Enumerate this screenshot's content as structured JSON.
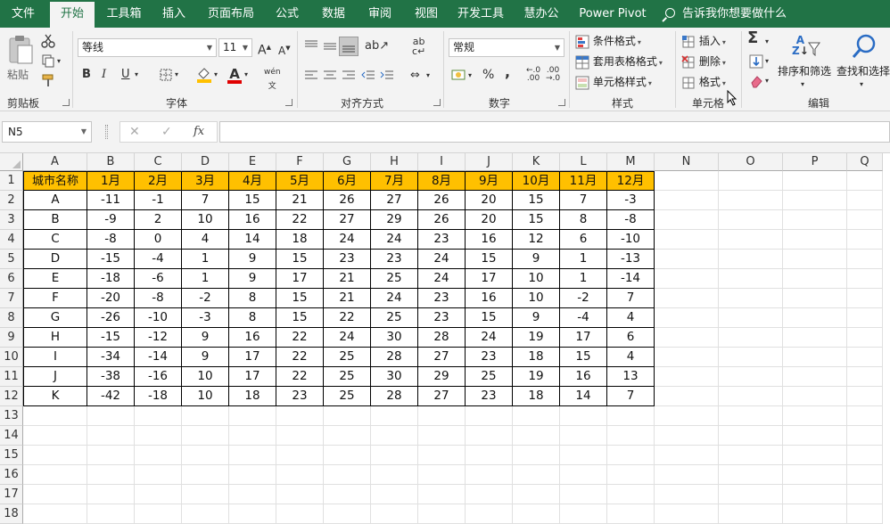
{
  "menu": {
    "tabs": [
      "文件",
      "开始",
      "工具箱",
      "插入",
      "页面布局",
      "公式",
      "数据",
      "审阅",
      "视图",
      "开发工具",
      "慧办公",
      "Power Pivot"
    ],
    "active": "开始",
    "tell_me": "告诉我你想要做什么"
  },
  "ribbon": {
    "clipboard": {
      "paste": "粘贴",
      "label": "剪贴板"
    },
    "font": {
      "name": "等线",
      "size": "11",
      "bold": "B",
      "italic": "I",
      "underline": "U",
      "label": "字体",
      "grow": "A",
      "shrink": "A",
      "phonetic": "wén"
    },
    "alignment": {
      "label": "对齐方式"
    },
    "number": {
      "format": "常规",
      "label": "数字",
      "percent": "%",
      "comma": ","
    },
    "styles": {
      "conditional": "条件格式",
      "table": "套用表格格式",
      "cell": "单元格样式",
      "label": "样式"
    },
    "cells": {
      "insert": "插入",
      "delete": "删除",
      "format": "格式",
      "label": "单元格"
    },
    "editing": {
      "sort": "排序和筛选",
      "find": "查找和选择",
      "label": "编辑"
    }
  },
  "formula_bar": {
    "name_box": "N5",
    "fx": "fx",
    "formula": ""
  },
  "grid": {
    "columns": [
      "A",
      "B",
      "C",
      "D",
      "E",
      "F",
      "G",
      "H",
      "I",
      "J",
      "K",
      "L",
      "M",
      "N",
      "O",
      "P",
      "Q"
    ],
    "rows": [
      "1",
      "2",
      "3",
      "4",
      "5",
      "6",
      "7",
      "8",
      "9",
      "10",
      "11",
      "12",
      "13",
      "14",
      "15",
      "16",
      "17",
      "18"
    ],
    "header": [
      "城市名称",
      "1月",
      "2月",
      "3月",
      "4月",
      "5月",
      "6月",
      "7月",
      "8月",
      "9月",
      "10月",
      "11月",
      "12月"
    ],
    "data": [
      [
        "A",
        "-11",
        "-1",
        "7",
        "15",
        "21",
        "26",
        "27",
        "26",
        "20",
        "15",
        "7",
        "-3"
      ],
      [
        "B",
        "-9",
        "2",
        "10",
        "16",
        "22",
        "27",
        "29",
        "26",
        "20",
        "15",
        "8",
        "-8"
      ],
      [
        "C",
        "-8",
        "0",
        "4",
        "14",
        "18",
        "24",
        "24",
        "23",
        "16",
        "12",
        "6",
        "-10"
      ],
      [
        "D",
        "-15",
        "-4",
        "1",
        "9",
        "15",
        "23",
        "23",
        "24",
        "15",
        "9",
        "1",
        "-13"
      ],
      [
        "E",
        "-18",
        "-6",
        "1",
        "9",
        "17",
        "21",
        "25",
        "24",
        "17",
        "10",
        "1",
        "-14"
      ],
      [
        "F",
        "-20",
        "-8",
        "-2",
        "8",
        "15",
        "21",
        "24",
        "23",
        "16",
        "10",
        "-2",
        "7"
      ],
      [
        "G",
        "-26",
        "-10",
        "-3",
        "8",
        "15",
        "22",
        "25",
        "23",
        "15",
        "9",
        "-4",
        "4"
      ],
      [
        "H",
        "-15",
        "-12",
        "9",
        "16",
        "22",
        "24",
        "30",
        "28",
        "24",
        "19",
        "17",
        "6"
      ],
      [
        "I",
        "-34",
        "-14",
        "9",
        "17",
        "22",
        "25",
        "28",
        "27",
        "23",
        "18",
        "15",
        "4"
      ],
      [
        "J",
        "-38",
        "-16",
        "10",
        "17",
        "22",
        "25",
        "30",
        "29",
        "25",
        "19",
        "16",
        "13"
      ],
      [
        "K",
        "-42",
        "-18",
        "10",
        "18",
        "23",
        "25",
        "28",
        "27",
        "23",
        "18",
        "14",
        "7"
      ]
    ]
  },
  "colors": {
    "excel_green": "#217346",
    "header_fill": "#ffc000"
  }
}
